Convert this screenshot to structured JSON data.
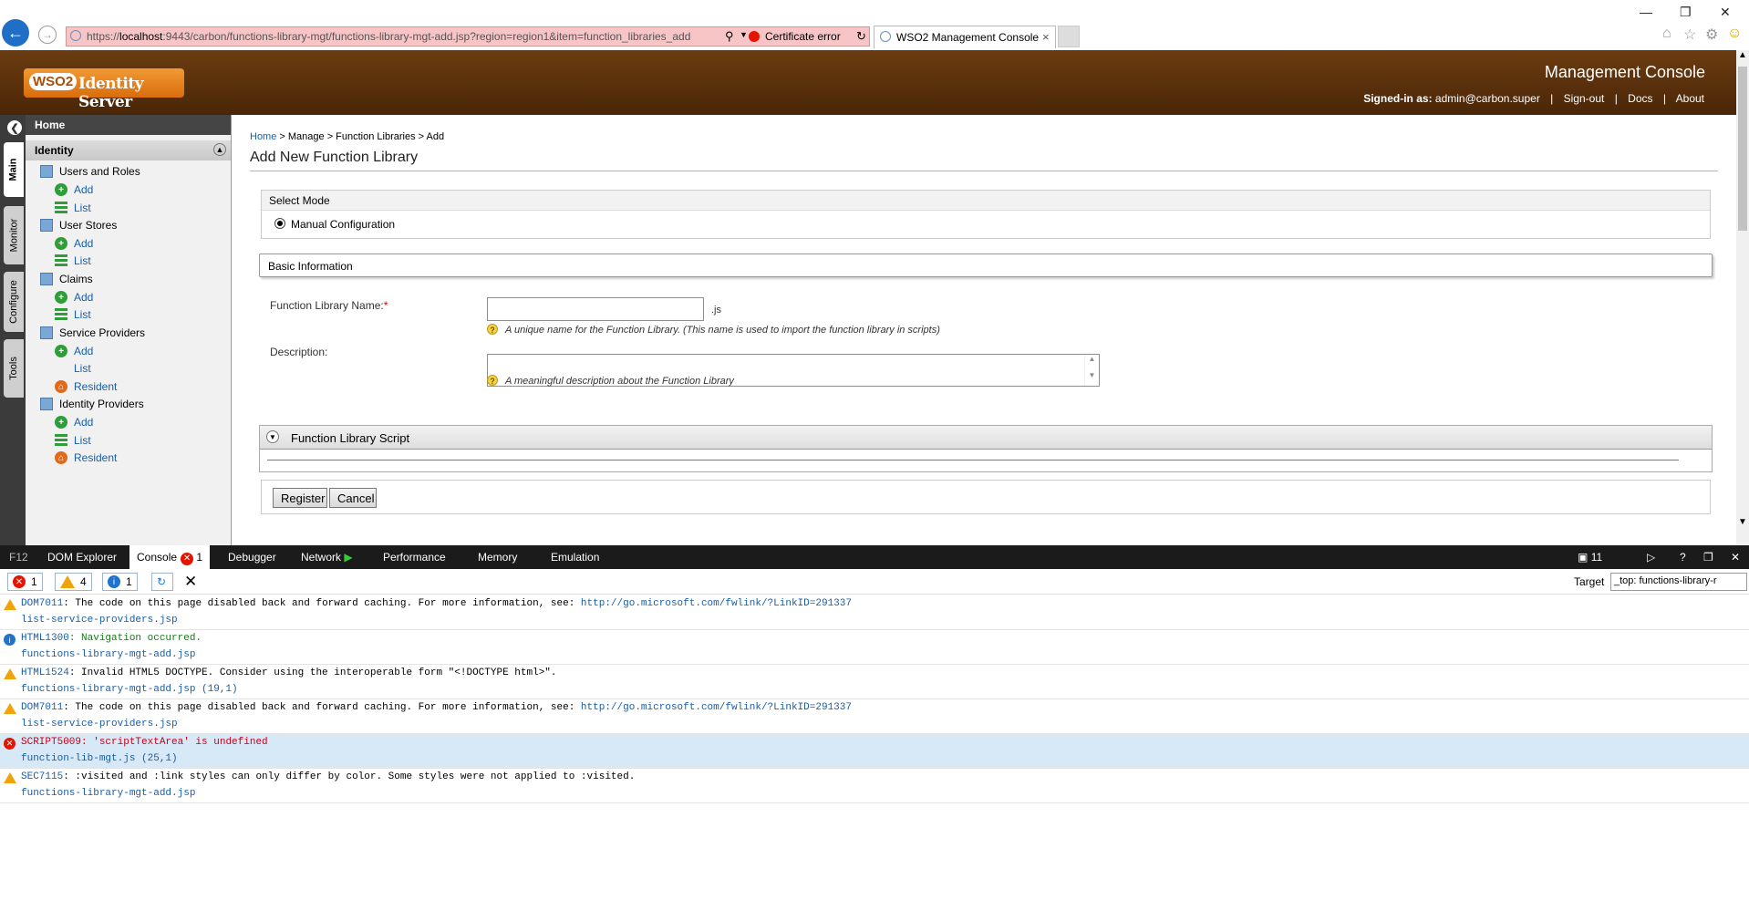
{
  "browser": {
    "url_prefix": "https://",
    "url_host": "localhost",
    "url_rest": ":9443/carbon/functions-library-mgt/functions-library-mgt-add.jsp?region=region1&item=function_libraries_add",
    "cert_error": "Certificate error",
    "tab_title": "WSO2 Management Console"
  },
  "header": {
    "logo_wso2": "WSO2",
    "logo_product": "Identity Server",
    "console_title": "Management Console",
    "signed_in_label": "Signed-in as:",
    "signed_in_user": "admin@carbon.super",
    "links": [
      "Sign-out",
      "Docs",
      "About"
    ]
  },
  "side_tabs": [
    "Main",
    "Monitor",
    "Configure",
    "Tools"
  ],
  "menu": {
    "home": "Home",
    "section": "Identity",
    "categories": [
      {
        "label": "Users and Roles",
        "items": [
          "Add",
          "List"
        ]
      },
      {
        "label": "User Stores",
        "items": [
          "Add",
          "List"
        ]
      },
      {
        "label": "Claims",
        "items": [
          "Add",
          "List"
        ]
      },
      {
        "label": "Service Providers",
        "items": [
          "Add",
          "List",
          "Resident"
        ]
      },
      {
        "label": "Identity Providers",
        "items": [
          "Add",
          "List",
          "Resident"
        ]
      }
    ]
  },
  "breadcrumb": {
    "home": "Home",
    "rest": " > Manage > Function Libraries > Add"
  },
  "page": {
    "title": "Add New Function Library",
    "select_mode": "Select Mode",
    "manual_config": "Manual Configuration",
    "basic_info": "Basic Information",
    "name_label": "Function Library Name:",
    "name_required": "*",
    "name_value": "",
    "js_suffix": ".js",
    "name_help": "A unique name for the Function Library. (This name is used to import the function library in scripts)",
    "desc_label": "Description:",
    "desc_value": "",
    "desc_help": "A meaningful description about the Function Library",
    "script_section": "Function Library Script",
    "register": "Register",
    "cancel": "Cancel"
  },
  "devtools": {
    "tabs": [
      "F12",
      "DOM Explorer",
      "Console",
      "Debugger",
      "Network",
      "Performance",
      "Memory",
      "Emulation"
    ],
    "console_badge": "1",
    "error_count": "1",
    "warning_count": "4",
    "info_count": "1",
    "emulation_count": "11",
    "target_label": "Target",
    "target_value": "_top: functions-library-r"
  },
  "console_messages": [
    {
      "level": "warning",
      "code": "DOM7011",
      "text": ": The code on this page disabled back and forward caching. For more information, see: ",
      "link": "http://go.microsoft.com/fwlink/?LinkID=291337",
      "source": "list-service-providers.jsp"
    },
    {
      "level": "info",
      "code": "HTML1300",
      "text": ": Navigation occurred.",
      "link": "",
      "source": "functions-library-mgt-add.jsp"
    },
    {
      "level": "warning",
      "code": "HTML1524",
      "text": ": Invalid HTML5 DOCTYPE. Consider using the interoperable form \"<!DOCTYPE html>\".",
      "link": "",
      "source": "functions-library-mgt-add.jsp (19,1)"
    },
    {
      "level": "warning",
      "code": "DOM7011",
      "text": ": The code on this page disabled back and forward caching. For more information, see: ",
      "link": "http://go.microsoft.com/fwlink/?LinkID=291337",
      "source": "list-service-providers.jsp"
    },
    {
      "level": "error",
      "code": "SCRIPT5009",
      "text": ": 'scriptTextArea' is undefined",
      "link": "",
      "source": "function-lib-mgt.js (25,1)"
    },
    {
      "level": "warning",
      "code": "SEC7115",
      "text": ": :visited and :link styles can only differ by color. Some styles were not applied to :visited.",
      "link": "",
      "source": "functions-library-mgt-add.jsp"
    }
  ]
}
